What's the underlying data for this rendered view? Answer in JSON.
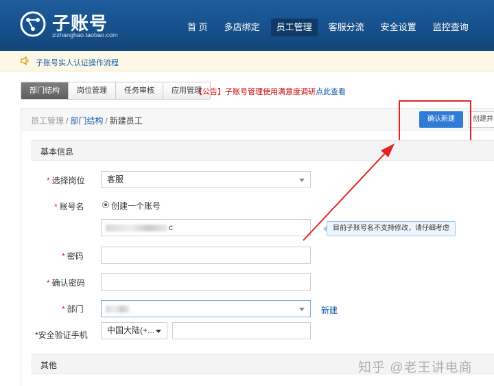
{
  "header": {
    "logo_title": "子账号",
    "logo_sub": "zizhanghao.taobao.com",
    "nav": [
      "首 页",
      "多店绑定",
      "员工管理",
      "客服分流",
      "安全设置",
      "监控查询"
    ],
    "nav_active_index": 2
  },
  "notice": {
    "link_text": "子账号实人认证操作流程"
  },
  "tabs": [
    "部门结构",
    "岗位管理",
    "任务审核",
    "应用管理"
  ],
  "announcement": {
    "tag": "【公告】",
    "text": "子账号管理使用满意度调研",
    "link": "点此查看"
  },
  "breadcrumb": {
    "item1": "员工管理",
    "item2": "部门结构",
    "current": "新建员工",
    "sep": "/"
  },
  "buttons": {
    "confirm": "确认新建",
    "create_more": "创建并继续"
  },
  "basic_section": {
    "title": "基本信息"
  },
  "form": {
    "required_mark": "*",
    "position_label": "选择岗位",
    "position_value": "客服",
    "account_label": "账号名",
    "account_radio": "创建一个账号",
    "account_value_tail": "c",
    "account_tip": "目前子账号名不支持修改，请仔细考虑",
    "password_label": "密码",
    "confirm_password_label": "确认密码",
    "department_label": "部门",
    "department_new": "新建",
    "phone_label": "*安全验证手机",
    "phone_region": "中国大陆(+..."
  },
  "other_section": {
    "title": "其他"
  },
  "watermark": "知乎 @老王讲电商",
  "colors": {
    "header": "#16518c",
    "accent": "#2f7bd6",
    "highlight": "#e02424"
  }
}
